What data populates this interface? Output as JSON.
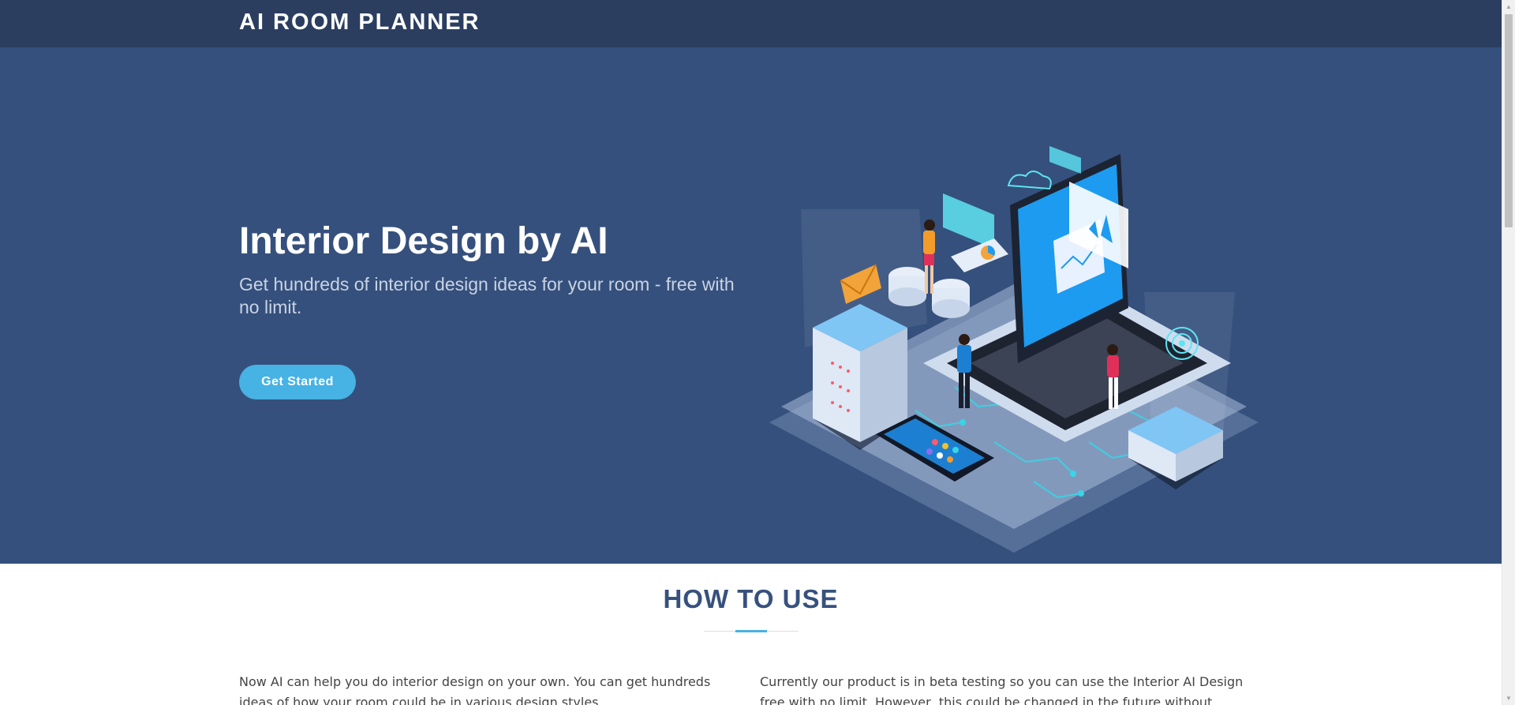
{
  "header": {
    "logo": "AI ROOM PLANNER"
  },
  "hero": {
    "title": "Interior Design by AI",
    "subtitle": "Get hundreds of interior design ideas for your room - free with no limit.",
    "cta_label": "Get Started",
    "illustration_icon": "isometric-tech-illustration"
  },
  "how_to_use": {
    "title": "HOW TO USE",
    "left_text": "Now AI can help you do interior design on your own. You can get hundreds ideas of how your room could be in various design styles.",
    "right_text": "Currently our product is in beta testing so you can use the Interior AI Design free with no limit. However, this could be changed in the future without notification. So let's go"
  },
  "colors": {
    "header_bg": "#2b3e60",
    "hero_bg": "#35507c",
    "accent": "#47b2e4",
    "section_title": "#37517e"
  }
}
